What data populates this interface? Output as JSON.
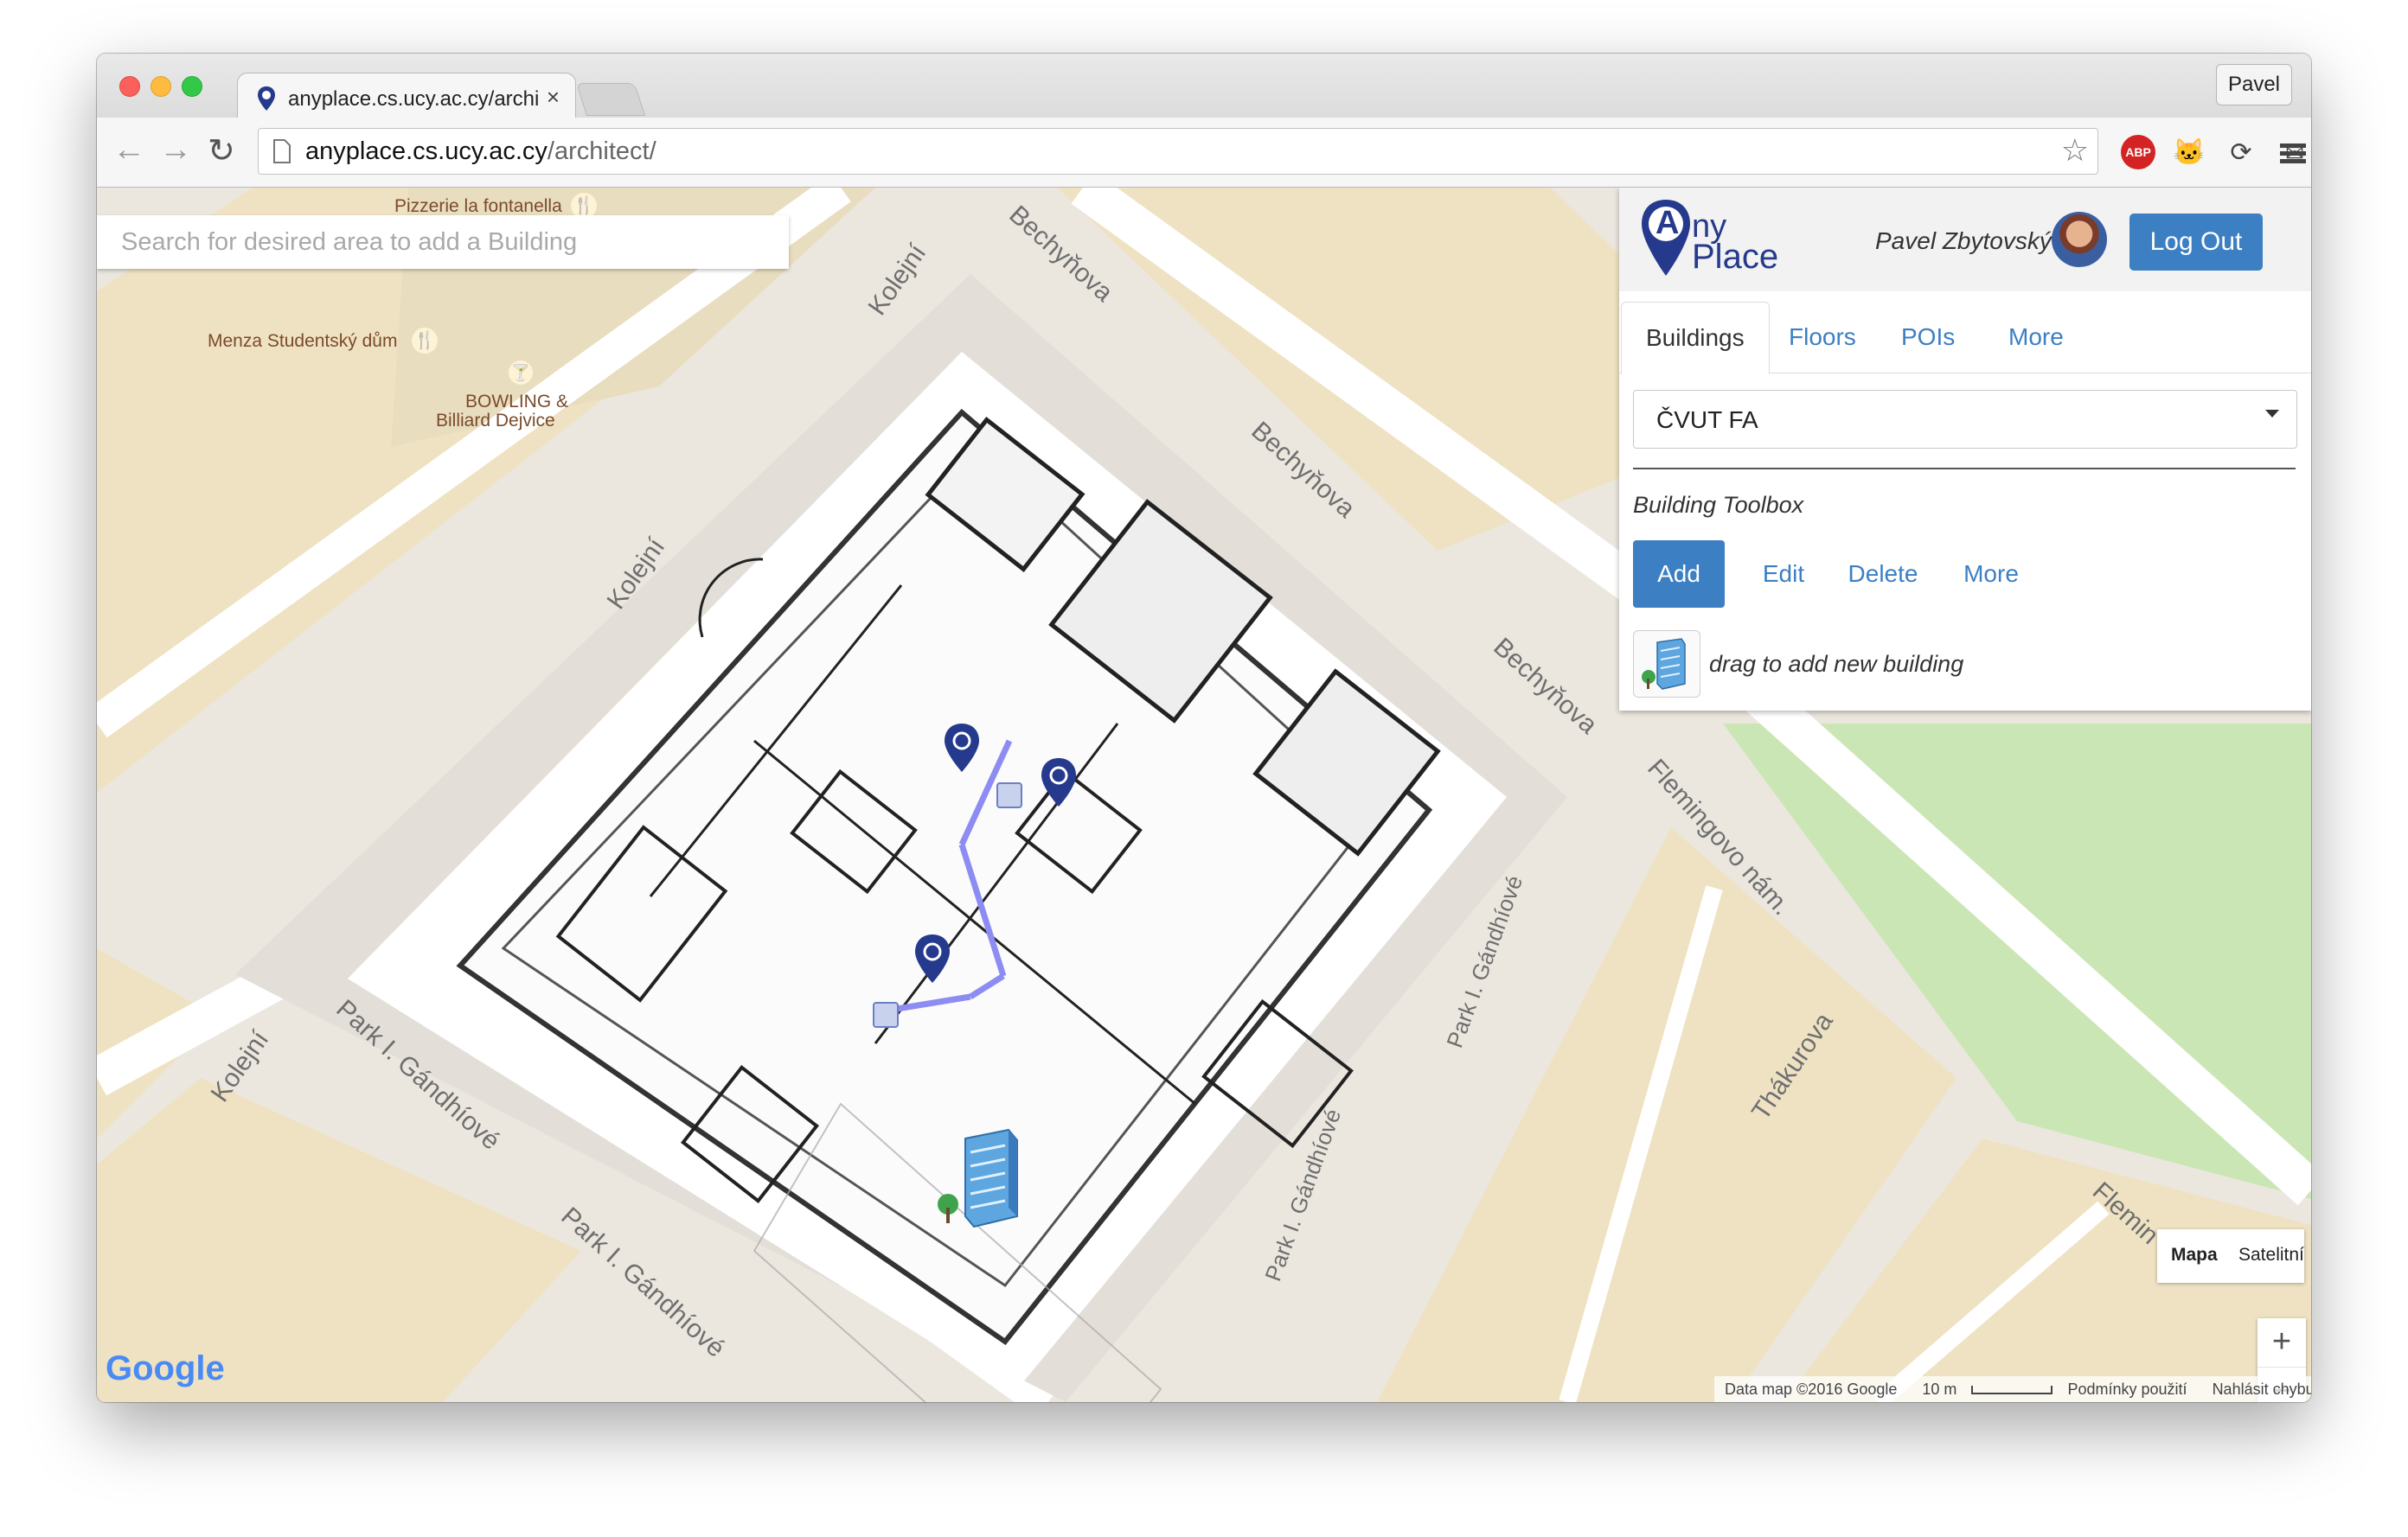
{
  "browser": {
    "tab_title": "anyplace.cs.ucy.ac.cy/architect/",
    "profile_name": "Pavel",
    "url_host": "anyplace.cs.ucy.ac.cy",
    "url_path": "/architect/",
    "extensions": [
      "star-icon",
      "adblock-icon",
      "octocat-icon",
      "sync-icon",
      "mail-icon",
      "menu-icon"
    ],
    "adblock_label": "ABP"
  },
  "map": {
    "search_placeholder": "Search for desired area to add a Building",
    "pois": [
      {
        "name": "Pizzerie la fontanella"
      },
      {
        "name": "Menza Studentský dům"
      },
      {
        "name": "BOWLING &"
      },
      {
        "name": "Billiard Dejvice"
      }
    ],
    "streets": [
      "Kolejní",
      "Bechyňova",
      "Bechyňova",
      "Bechyňova",
      "Kolejní",
      "Kolejní",
      "Park I. Gándhíové",
      "Park I. Gándhíové",
      "Park I. Gándhíové",
      "Park I. Gándhíové",
      "Flemingovo nám.",
      "Thákurova",
      "Flemin"
    ],
    "map_type_options": [
      "Mapa",
      "Satelitní"
    ],
    "map_type_selected": "Mapa",
    "zoom_in": "+",
    "zoom_out": "−",
    "attribution": [
      "Data map ©2016 Google",
      "10 m",
      "Podmínky použití",
      "Nahlásit chybu v mapě"
    ],
    "google_logo": "Google",
    "colors": {
      "route": "#7b7bef",
      "marker": "#253a8c",
      "grass": "#cbe6b5",
      "sand": "#efe2c3"
    }
  },
  "panel": {
    "logo_line1": "ny",
    "logo_line2": "Place",
    "logo_letter": "A",
    "user_name": "Pavel Zbytovský",
    "logout_label": "Log Out",
    "tabs": [
      "Buildings",
      "Floors",
      "POIs",
      "More"
    ],
    "active_tab": "Buildings",
    "building_select": "ČVUT FA",
    "toolbox_title": "Building Toolbox",
    "toolbox_buttons": [
      "Add",
      "Edit",
      "Delete",
      "More"
    ],
    "drag_hint": "drag to add new building",
    "accent_color": "#3c7fc3"
  }
}
